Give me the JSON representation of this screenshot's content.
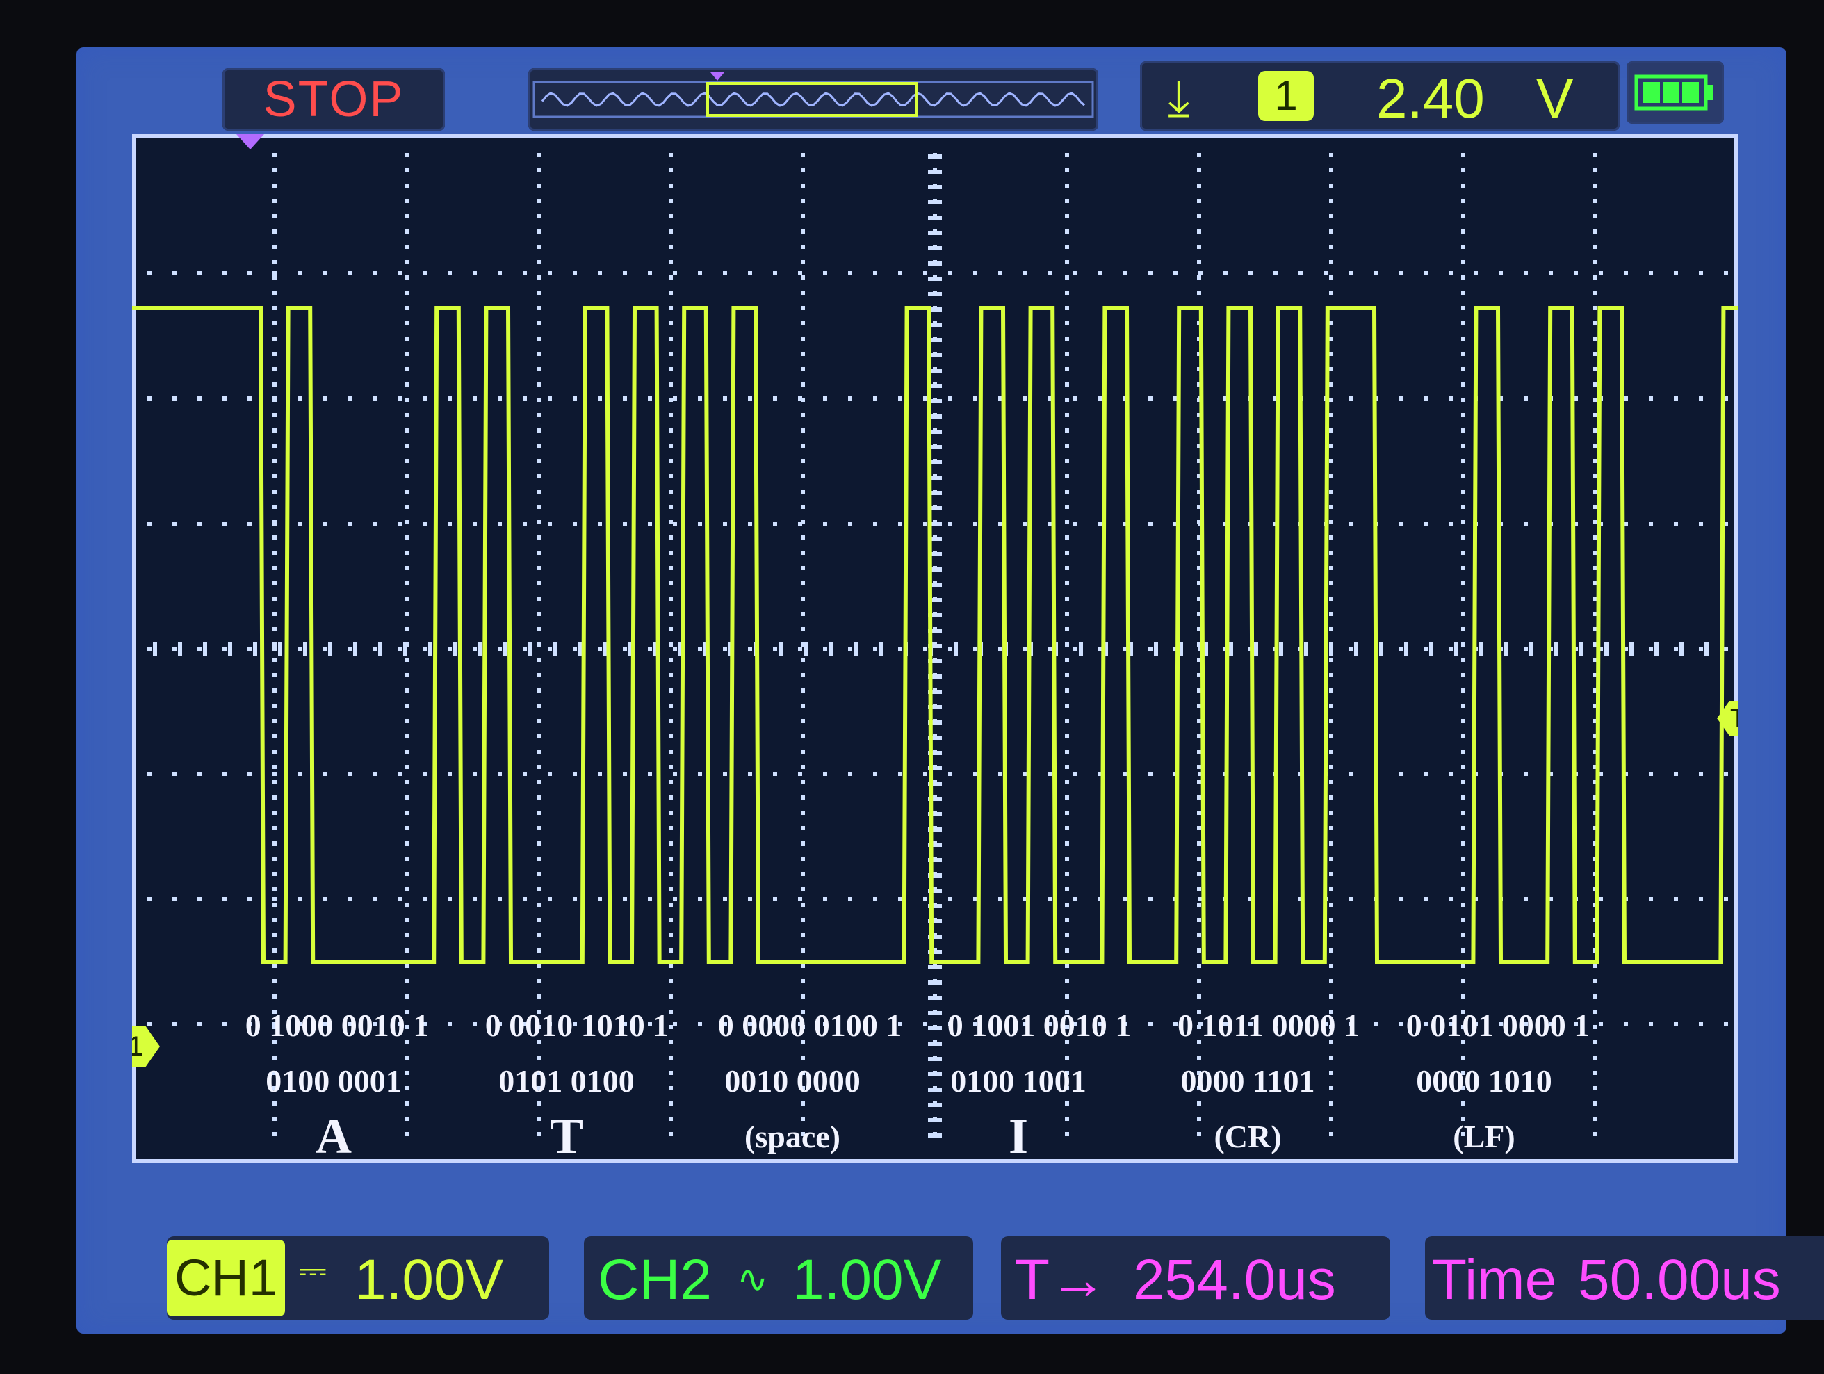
{
  "status": {
    "run_state": "STOP"
  },
  "trigger": {
    "edge_icon": "falling-edge-trigger-icon",
    "channel": "1",
    "level": "2.40",
    "unit": "V"
  },
  "battery": {
    "icon": "battery-icon",
    "level_fraction": 1.0
  },
  "markers": {
    "ch1": "1",
    "trigger": "T"
  },
  "annotations": [
    {
      "bits": "0 1000 0010 1",
      "hex": "0100 0001",
      "char": "A"
    },
    {
      "bits": "0 0010 1010 1",
      "hex": "0101 0100",
      "char": "T"
    },
    {
      "bits": "0 0000 0100 1",
      "hex": "0010 0000",
      "char": "(space)"
    },
    {
      "bits": "0 1001 0010 1",
      "hex": "0100 1001",
      "char": "I"
    },
    {
      "bits": "0 1011 0000 1",
      "hex": "0000 1101",
      "char": "(CR)"
    },
    {
      "bits": "0 0101 0000 1",
      "hex": "0000 1010",
      "char": "(LF)"
    }
  ],
  "bottom": {
    "ch1": {
      "label": "CH1",
      "coupling": "⎓",
      "scale": "1.00V"
    },
    "ch2": {
      "label": "CH2",
      "coupling": "∿",
      "scale": "1.00V"
    },
    "trigger_offset": {
      "label": "T→",
      "value": "254.0us"
    },
    "timebase": {
      "label": "Time",
      "value": "50.00us"
    }
  },
  "colors": {
    "trace": "#d8ff3a",
    "grid": "#cfe0ff",
    "background": "#0d1830"
  }
}
